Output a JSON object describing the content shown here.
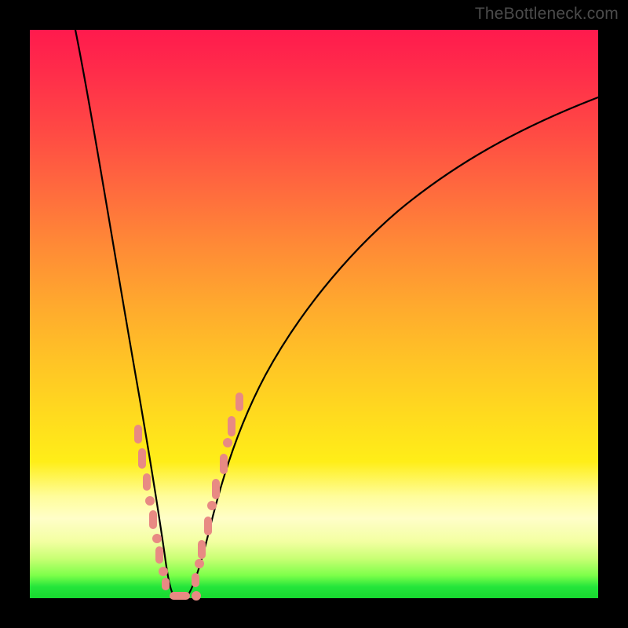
{
  "watermark": "TheBottleneck.com",
  "colors": {
    "frame": "#000000",
    "gradient_top": "#ff1a4d",
    "gradient_mid": "#ffdb1e",
    "gradient_bottom": "#17d92f",
    "curve": "#000000",
    "bead": "#e88a83"
  },
  "chart_data": {
    "type": "line",
    "title": "",
    "xlabel": "",
    "ylabel": "",
    "xlim": [
      0,
      100
    ],
    "ylim": [
      0,
      100
    ],
    "x": [
      8,
      10,
      12,
      14,
      16,
      18,
      19,
      20,
      21,
      22,
      23,
      24,
      25,
      26,
      28,
      30,
      33,
      36,
      40,
      45,
      50,
      56,
      63,
      70,
      78,
      86,
      95,
      100
    ],
    "values": [
      100,
      88,
      76,
      64,
      52,
      40,
      33,
      26,
      19,
      12,
      6,
      2,
      0,
      2,
      8,
      16,
      26,
      35,
      44,
      53,
      60,
      66,
      72,
      77,
      81,
      84.5,
      87.5,
      89
    ],
    "annotations": {
      "bead_clusters": [
        {
          "side": "left",
          "y_range": [
            8,
            30
          ]
        },
        {
          "side": "right",
          "y_range": [
            2,
            32
          ]
        },
        {
          "side": "bottom",
          "y_range": [
            0,
            2
          ]
        }
      ]
    }
  }
}
